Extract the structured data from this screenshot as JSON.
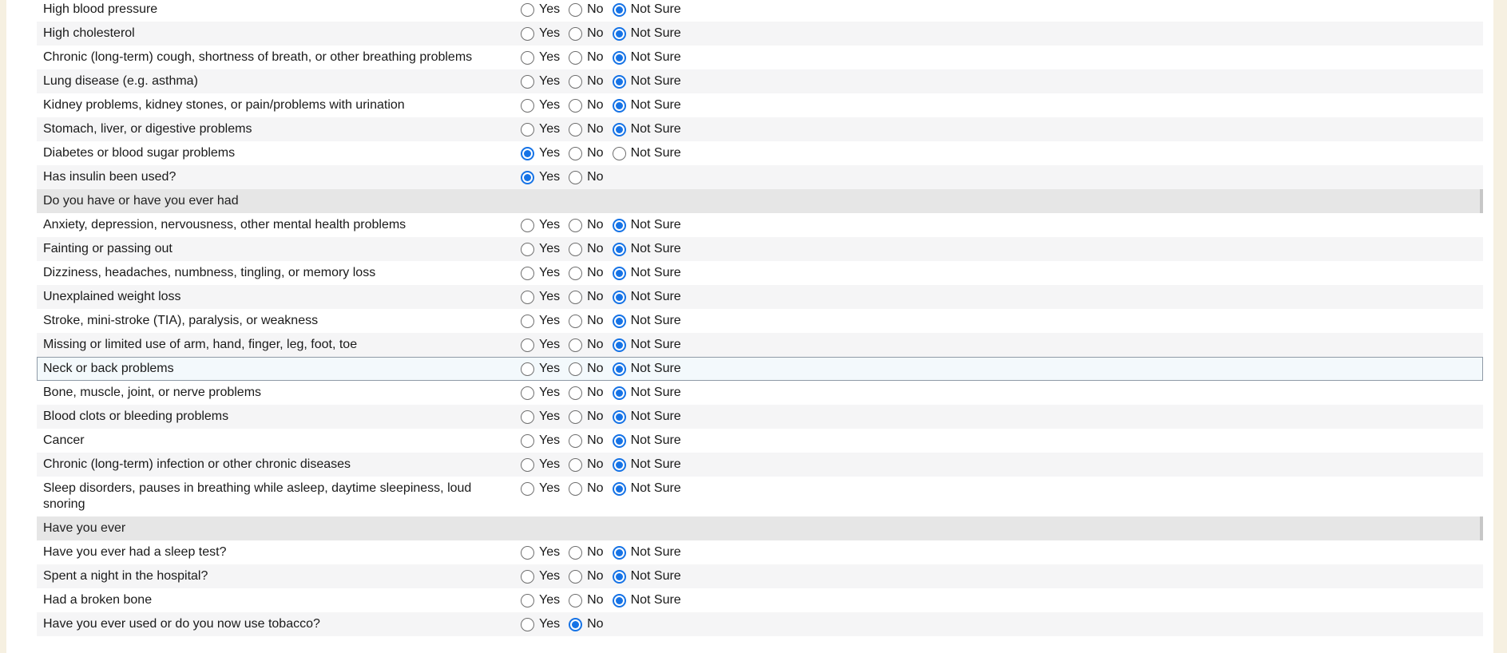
{
  "rows": [
    {
      "type": "q",
      "label": "High blood pressure",
      "options": [
        "Yes",
        "No",
        "Not Sure"
      ],
      "selected": "Not Sure",
      "alt": false
    },
    {
      "type": "q",
      "label": "High cholesterol",
      "options": [
        "Yes",
        "No",
        "Not Sure"
      ],
      "selected": "Not Sure",
      "alt": true
    },
    {
      "type": "q",
      "label": "Chronic (long-term) cough, shortness of breath, or other breathing problems",
      "options": [
        "Yes",
        "No",
        "Not Sure"
      ],
      "selected": "Not Sure",
      "alt": false
    },
    {
      "type": "q",
      "label": "Lung disease (e.g. asthma)",
      "options": [
        "Yes",
        "No",
        "Not Sure"
      ],
      "selected": "Not Sure",
      "alt": true
    },
    {
      "type": "q",
      "label": "Kidney problems, kidney stones, or pain/problems with urination",
      "options": [
        "Yes",
        "No",
        "Not Sure"
      ],
      "selected": "Not Sure",
      "alt": false
    },
    {
      "type": "q",
      "label": "Stomach, liver, or digestive problems",
      "options": [
        "Yes",
        "No",
        "Not Sure"
      ],
      "selected": "Not Sure",
      "alt": true
    },
    {
      "type": "q",
      "label": "Diabetes or blood sugar problems",
      "options": [
        "Yes",
        "No",
        "Not Sure"
      ],
      "selected": "Yes",
      "alt": false
    },
    {
      "type": "q",
      "label": "Has insulin been used?",
      "options": [
        "Yes",
        "No"
      ],
      "selected": "Yes",
      "alt": true
    },
    {
      "type": "section",
      "label": "Do you have or have you ever had"
    },
    {
      "type": "q",
      "label": "Anxiety, depression, nervousness, other mental health problems",
      "options": [
        "Yes",
        "No",
        "Not Sure"
      ],
      "selected": "Not Sure",
      "alt": false
    },
    {
      "type": "q",
      "label": "Fainting or passing out",
      "options": [
        "Yes",
        "No",
        "Not Sure"
      ],
      "selected": "Not Sure",
      "alt": true
    },
    {
      "type": "q",
      "label": "Dizziness, headaches, numbness, tingling, or memory loss",
      "options": [
        "Yes",
        "No",
        "Not Sure"
      ],
      "selected": "Not Sure",
      "alt": false
    },
    {
      "type": "q",
      "label": "Unexplained weight loss",
      "options": [
        "Yes",
        "No",
        "Not Sure"
      ],
      "selected": "Not Sure",
      "alt": true
    },
    {
      "type": "q",
      "label": "Stroke, mini-stroke (TIA), paralysis, or weakness",
      "options": [
        "Yes",
        "No",
        "Not Sure"
      ],
      "selected": "Not Sure",
      "alt": false
    },
    {
      "type": "q",
      "label": "Missing or limited use of arm, hand, finger, leg, foot, toe",
      "options": [
        "Yes",
        "No",
        "Not Sure"
      ],
      "selected": "Not Sure",
      "alt": true
    },
    {
      "type": "q",
      "label": "Neck or back problems",
      "options": [
        "Yes",
        "No",
        "Not Sure"
      ],
      "selected": "Not Sure",
      "alt": false,
      "focused": true
    },
    {
      "type": "q",
      "label": "Bone, muscle, joint, or nerve problems",
      "options": [
        "Yes",
        "No",
        "Not Sure"
      ],
      "selected": "Not Sure",
      "alt": false
    },
    {
      "type": "q",
      "label": "Blood clots or bleeding problems",
      "options": [
        "Yes",
        "No",
        "Not Sure"
      ],
      "selected": "Not Sure",
      "alt": true
    },
    {
      "type": "q",
      "label": "Cancer",
      "options": [
        "Yes",
        "No",
        "Not Sure"
      ],
      "selected": "Not Sure",
      "alt": false
    },
    {
      "type": "q",
      "label": "Chronic (long-term) infection or other chronic diseases",
      "options": [
        "Yes",
        "No",
        "Not Sure"
      ],
      "selected": "Not Sure",
      "alt": true
    },
    {
      "type": "q",
      "label": "Sleep disorders, pauses in breathing while asleep, daytime sleepiness, loud snoring",
      "options": [
        "Yes",
        "No",
        "Not Sure"
      ],
      "selected": "Not Sure",
      "alt": false,
      "tall": true
    },
    {
      "type": "section",
      "label": "Have you ever"
    },
    {
      "type": "q",
      "label": "Have you ever had a sleep test?",
      "options": [
        "Yes",
        "No",
        "Not Sure"
      ],
      "selected": "Not Sure",
      "alt": false
    },
    {
      "type": "q",
      "label": "Spent a night in the hospital?",
      "options": [
        "Yes",
        "No",
        "Not Sure"
      ],
      "selected": "Not Sure",
      "alt": true
    },
    {
      "type": "q",
      "label": "Had a broken bone",
      "options": [
        "Yes",
        "No",
        "Not Sure"
      ],
      "selected": "Not Sure",
      "alt": false
    },
    {
      "type": "q",
      "label": "Have you ever used or do you now use tobacco?",
      "options": [
        "Yes",
        "No"
      ],
      "selected": "No",
      "alt": true
    }
  ],
  "colors": {
    "accent": "#1673e6",
    "page_background": "#f6f0e1",
    "section_background": "#e6e6e6",
    "alt_row": "#f5f5f6"
  }
}
